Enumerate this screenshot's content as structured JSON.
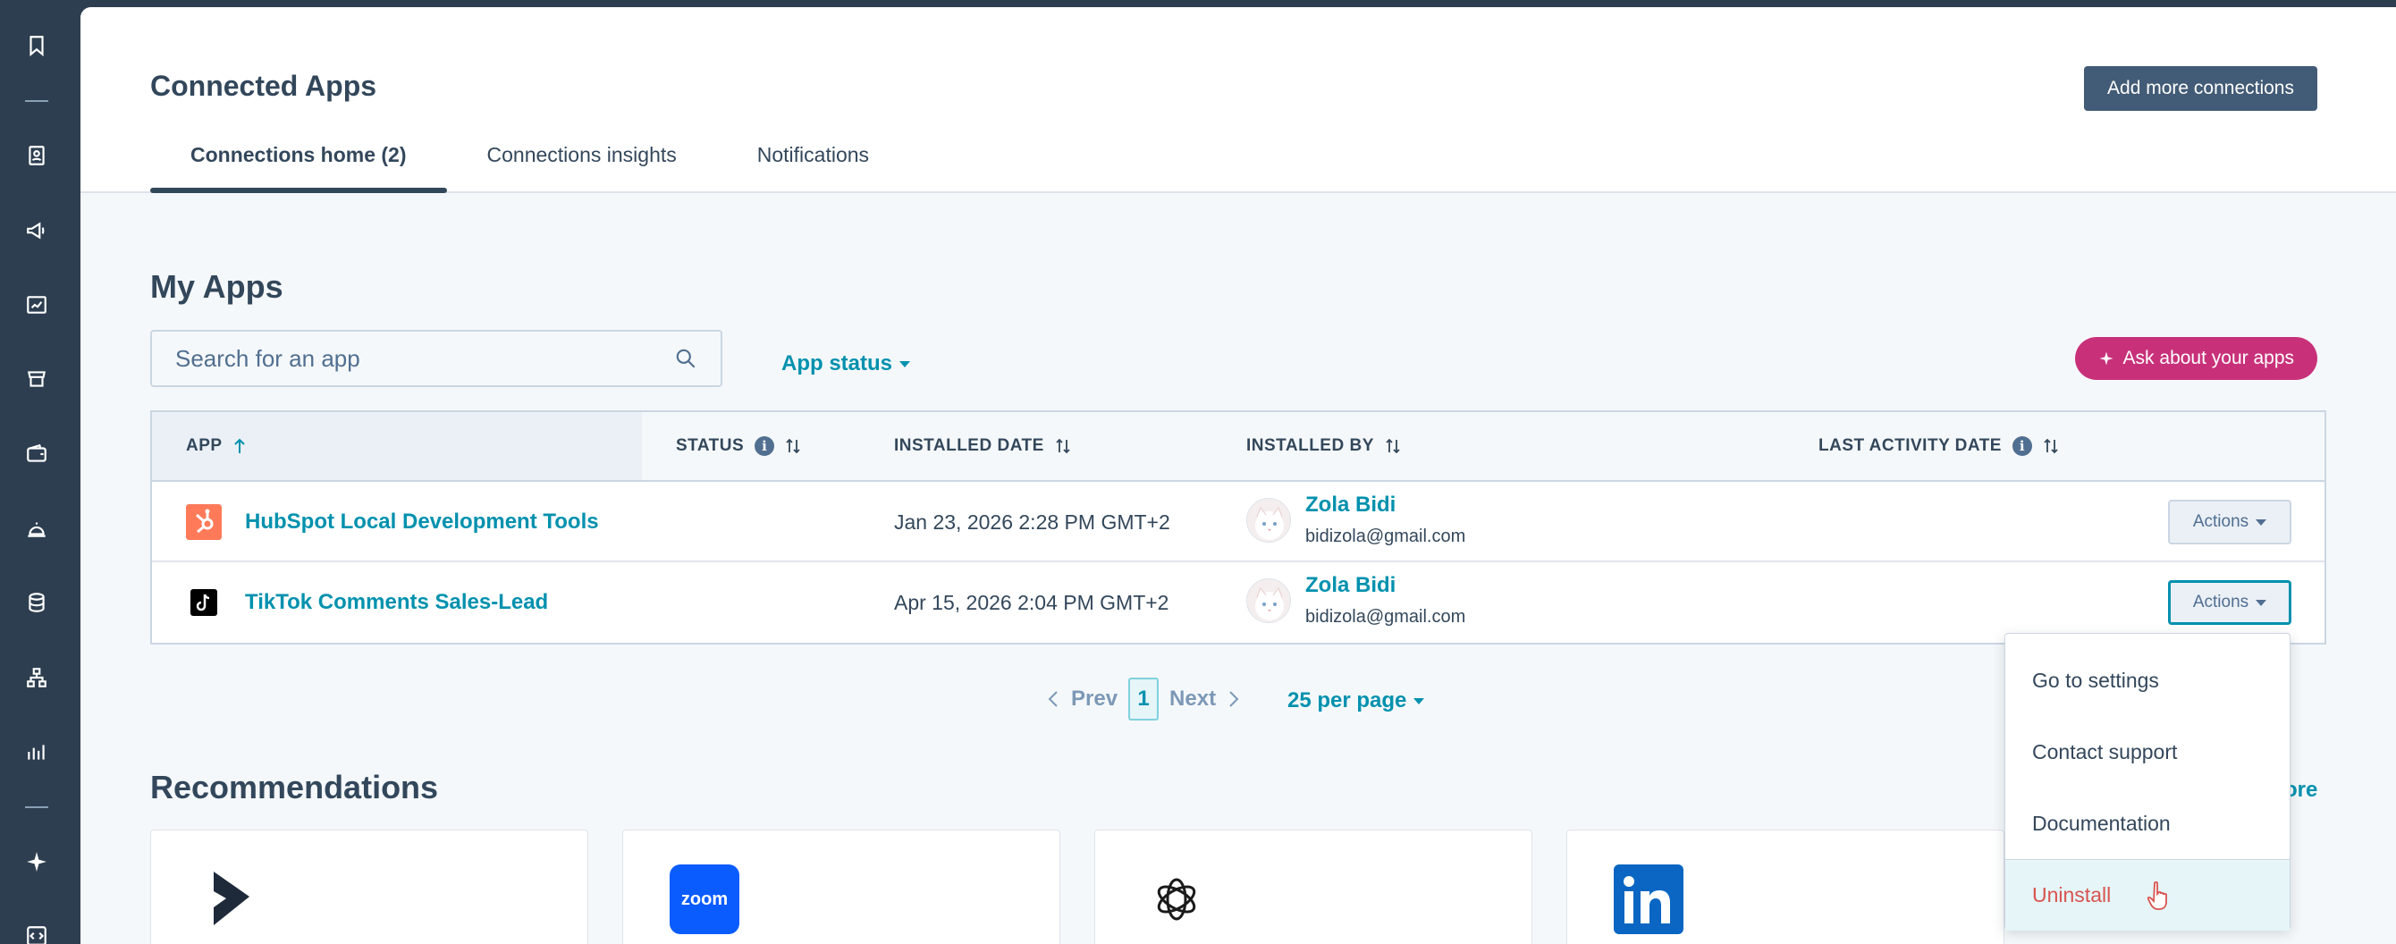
{
  "header": {
    "title": "Connected Apps",
    "add_button": "Add more connections",
    "tabs": [
      {
        "label": "Connections home (2)",
        "active": true
      },
      {
        "label": "Connections insights",
        "active": false
      },
      {
        "label": "Notifications",
        "active": false
      }
    ]
  },
  "my_apps": {
    "title": "My Apps",
    "search_placeholder": "Search for an app",
    "status_filter": "App status",
    "ai_button": "Ask about your apps"
  },
  "table": {
    "columns": {
      "app": "APP",
      "status": "STATUS",
      "installed_date": "INSTALLED DATE",
      "installed_by": "INSTALLED BY",
      "last_activity": "LAST ACTIVITY DATE"
    },
    "rows": [
      {
        "app": "HubSpot Local Development Tools",
        "logo": "hubspot-logo",
        "installed_date": "Jan 23, 2026 2:28 PM GMT+2",
        "user_name": "Zola Bidi",
        "user_email": "bidizola@gmail.com",
        "actions": "Actions"
      },
      {
        "app": "TikTok Comments Sales-Lead",
        "logo": "tiktok-logo",
        "installed_date": "Apr 15, 2026 2:04 PM GMT+2",
        "user_name": "Zola Bidi",
        "user_email": "bidizola@gmail.com",
        "actions": "Actions"
      }
    ]
  },
  "pagination": {
    "prev": "Prev",
    "page": "1",
    "next": "Next",
    "per_page": "25 per page"
  },
  "recommendations": {
    "title": "Recommendations",
    "see_more": "ore",
    "cards": [
      "dynamics-logo",
      "zoom-logo",
      "openai-logo",
      "linkedin-logo"
    ]
  },
  "actions_menu": {
    "items": [
      "Go to settings",
      "Contact support",
      "Documentation"
    ],
    "danger_item": "Uninstall"
  },
  "colors": {
    "nav_bg": "#2d3e50",
    "link": "#0091ae",
    "primary_dark": "#425b76",
    "ai_pink": "#c8317a",
    "danger": "#d9534f"
  }
}
